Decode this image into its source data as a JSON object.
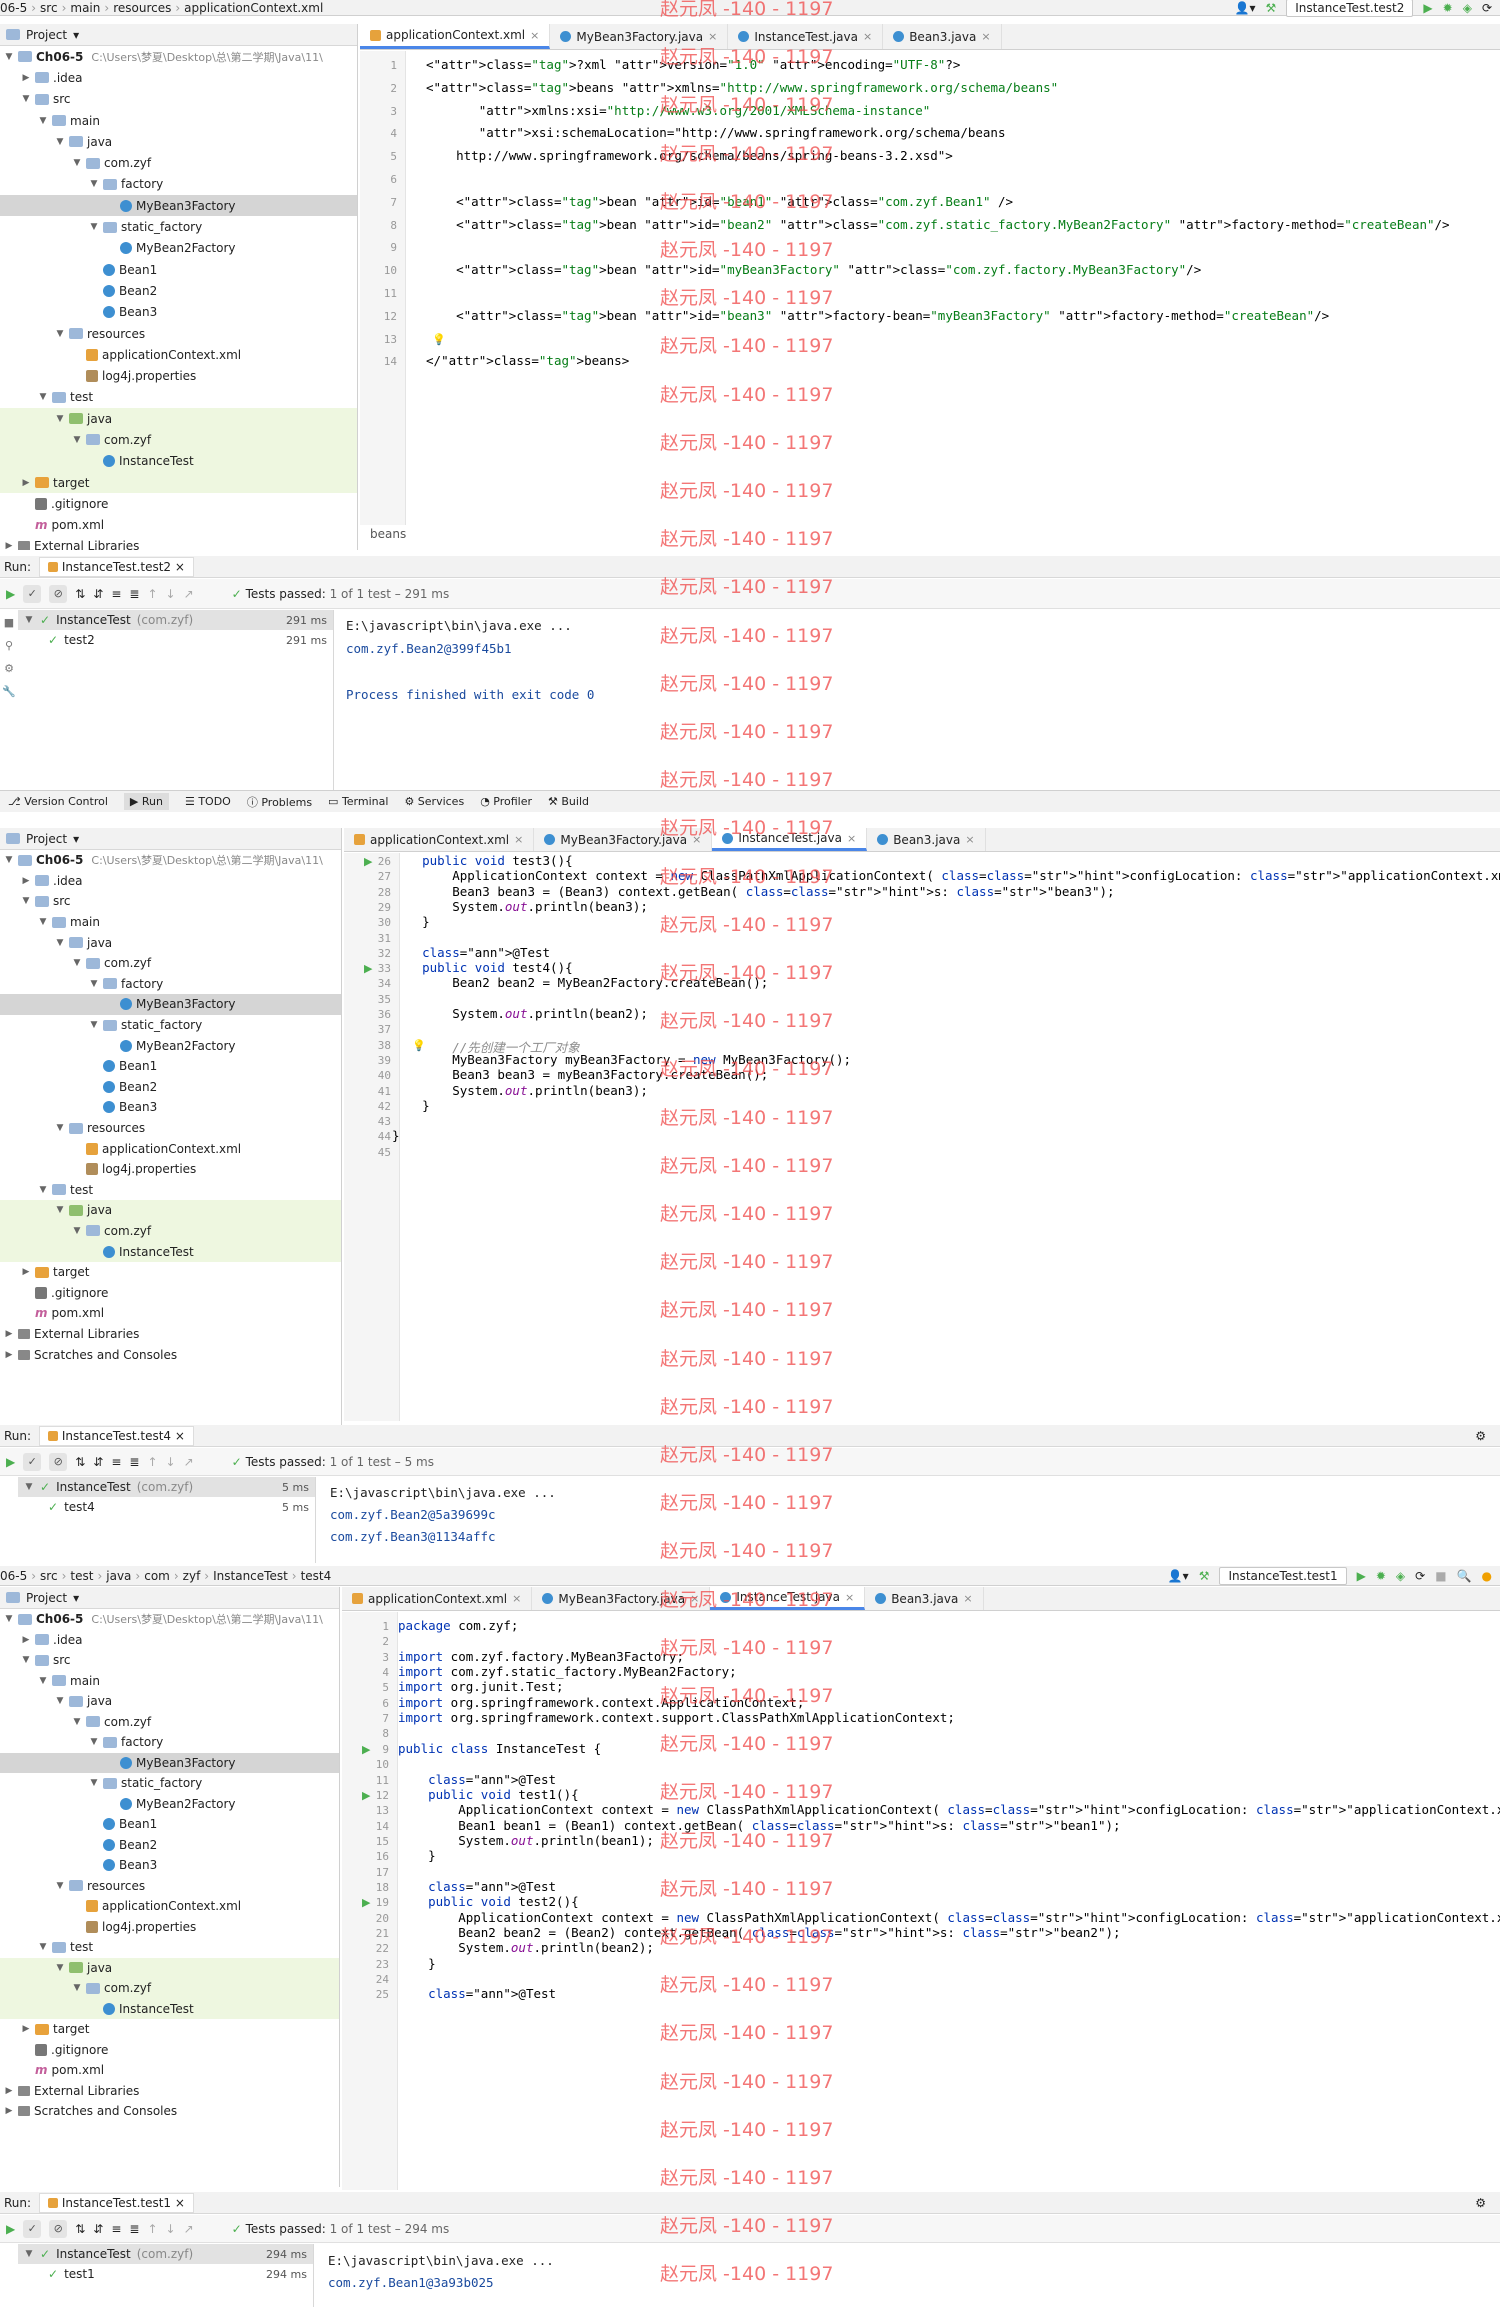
{
  "screenshot1": {
    "breadcrumb": [
      "06-5",
      "src",
      "main",
      "resources",
      "applicationContext.xml"
    ],
    "run_config": "InstanceTest.test2",
    "tabs": [
      {
        "label": "applicationContext.xml",
        "icon": "xml-file-icon",
        "active": true
      },
      {
        "label": "MyBean3Factory.java",
        "icon": "class-icon",
        "active": false
      },
      {
        "label": "InstanceTest.java",
        "icon": "class-icon",
        "active": false
      },
      {
        "label": "Bean3.java",
        "icon": "class-icon",
        "active": false
      }
    ],
    "project_label": "Project",
    "tree": [
      {
        "label": "Ch06-5",
        "path": "C:\\Users\\梦夏\\Desktop\\总\\第二学期\\Java\\11\\",
        "depth": 0,
        "icon": "folder",
        "open": true
      },
      {
        "label": ".idea",
        "depth": 1,
        "icon": "folder",
        "open": false
      },
      {
        "label": "src",
        "depth": 1,
        "icon": "folder",
        "open": true
      },
      {
        "label": "main",
        "depth": 2,
        "icon": "folder",
        "open": true
      },
      {
        "label": "java",
        "depth": 3,
        "icon": "folder",
        "open": true
      },
      {
        "label": "com.zyf",
        "depth": 4,
        "icon": "folder",
        "open": true
      },
      {
        "label": "factory",
        "depth": 5,
        "icon": "folder",
        "open": true
      },
      {
        "label": "MyBean3Factory",
        "depth": 6,
        "icon": "class",
        "selected": true
      },
      {
        "label": "static_factory",
        "depth": 5,
        "icon": "folder",
        "open": true
      },
      {
        "label": "MyBean2Factory",
        "depth": 6,
        "icon": "class"
      },
      {
        "label": "Bean1",
        "depth": 5,
        "icon": "class"
      },
      {
        "label": "Bean2",
        "depth": 5,
        "icon": "class"
      },
      {
        "label": "Bean3",
        "depth": 5,
        "icon": "class"
      },
      {
        "label": "resources",
        "depth": 3,
        "icon": "folder",
        "open": true
      },
      {
        "label": "applicationContext.xml",
        "depth": 4,
        "icon": "xml"
      },
      {
        "label": "log4j.properties",
        "depth": 4,
        "icon": "prop"
      },
      {
        "label": "test",
        "depth": 2,
        "icon": "folder",
        "open": true
      },
      {
        "label": "java",
        "depth": 3,
        "icon": "folderg",
        "open": true,
        "hl": true
      },
      {
        "label": "com.zyf",
        "depth": 4,
        "icon": "folder",
        "open": true,
        "hl": true
      },
      {
        "label": "InstanceTest",
        "depth": 5,
        "icon": "class",
        "hl": true
      },
      {
        "label": "target",
        "depth": 1,
        "icon": "foldero",
        "open": false,
        "hl": true
      },
      {
        "label": ".gitignore",
        "depth": 1,
        "icon": "git"
      },
      {
        "label": "pom.xml",
        "depth": 1,
        "icon": "m"
      },
      {
        "label": "External Libraries",
        "depth": 0,
        "icon": "lib",
        "open": false
      }
    ],
    "code_lines": [
      "<?xml version=\"1.0\" encoding=\"UTF-8\"?>",
      "<beans xmlns=\"http://www.springframework.org/schema/beans\"",
      "       xmlns:xsi=\"http://www.w3.org/2001/XMLSchema-instance\"",
      "       xsi:schemaLocation=\"http://www.springframework.org/schema/beans",
      "    http://www.springframework.org/schema/beans/spring-beans-3.2.xsd\">",
      "",
      "    <bean id=\"bean1\" class=\"com.zyf.Bean1\" />",
      "    <bean id=\"bean2\" class=\"com.zyf.static_factory.MyBean2Factory\" factory-method=\"createBean\"/>",
      "",
      "    <bean id=\"myBean3Factory\" class=\"com.zyf.factory.MyBean3Factory\"/>",
      "",
      "    <bean id=\"bean3\" factory-bean=\"myBean3Factory\" factory-method=\"createBean\"/>",
      "",
      "</beans>"
    ],
    "editor_breadcrumb": "beans",
    "run_label": "Run:",
    "run_tab": "InstanceTest.test2",
    "tests_passed": "Tests passed:",
    "tests_count": "1 of 1 test – 291 ms",
    "run_tree": [
      {
        "label": "InstanceTest",
        "sub": "(com.zyf)",
        "ms": "291 ms",
        "depth": 0
      },
      {
        "label": "test2",
        "ms": "291 ms",
        "depth": 1
      }
    ],
    "console": [
      "E:\\javascript\\bin\\java.exe ...",
      "com.zyf.Bean2@399f45b1",
      "",
      "Process finished with exit code 0"
    ],
    "status_tabs": [
      "Version Control",
      "Run",
      "TODO",
      "Problems",
      "Terminal",
      "Services",
      "Profiler",
      "Build"
    ]
  },
  "screenshot2": {
    "tabs": [
      {
        "label": "applicationContext.xml",
        "icon": "xml-file-icon",
        "active": false
      },
      {
        "label": "MyBean3Factory.java",
        "icon": "class-icon",
        "active": false
      },
      {
        "label": "InstanceTest.java",
        "icon": "class-icon",
        "active": true
      },
      {
        "label": "Bean3.java",
        "icon": "class-icon",
        "active": false
      }
    ],
    "project_label": "Project",
    "tree": [
      {
        "label": "Ch06-5",
        "path": "C:\\Users\\梦夏\\Desktop\\总\\第二学期\\Java\\11\\",
        "depth": 0,
        "icon": "folder",
        "open": true
      },
      {
        "label": ".idea",
        "depth": 1,
        "icon": "folder",
        "open": false
      },
      {
        "label": "src",
        "depth": 1,
        "icon": "folder",
        "open": true
      },
      {
        "label": "main",
        "depth": 2,
        "icon": "folder",
        "open": true
      },
      {
        "label": "java",
        "depth": 3,
        "icon": "folder",
        "open": true
      },
      {
        "label": "com.zyf",
        "depth": 4,
        "icon": "folder",
        "open": true
      },
      {
        "label": "factory",
        "depth": 5,
        "icon": "folder",
        "open": true
      },
      {
        "label": "MyBean3Factory",
        "depth": 6,
        "icon": "class",
        "selected": true
      },
      {
        "label": "static_factory",
        "depth": 5,
        "icon": "folder",
        "open": true
      },
      {
        "label": "MyBean2Factory",
        "depth": 6,
        "icon": "class"
      },
      {
        "label": "Bean1",
        "depth": 5,
        "icon": "class"
      },
      {
        "label": "Bean2",
        "depth": 5,
        "icon": "class"
      },
      {
        "label": "Bean3",
        "depth": 5,
        "icon": "class"
      },
      {
        "label": "resources",
        "depth": 3,
        "icon": "folder",
        "open": true
      },
      {
        "label": "applicationContext.xml",
        "depth": 4,
        "icon": "xml"
      },
      {
        "label": "log4j.properties",
        "depth": 4,
        "icon": "prop"
      },
      {
        "label": "test",
        "depth": 2,
        "icon": "folder",
        "open": true
      },
      {
        "label": "java",
        "depth": 3,
        "icon": "folderg",
        "open": true,
        "hl": true
      },
      {
        "label": "com.zyf",
        "depth": 4,
        "icon": "folder",
        "open": true,
        "hl": true
      },
      {
        "label": "InstanceTest",
        "depth": 5,
        "icon": "class",
        "hl": true
      },
      {
        "label": "target",
        "depth": 1,
        "icon": "foldero",
        "open": false
      },
      {
        "label": ".gitignore",
        "depth": 1,
        "icon": "git"
      },
      {
        "label": "pom.xml",
        "depth": 1,
        "icon": "m"
      },
      {
        "label": "External Libraries",
        "depth": 0,
        "icon": "lib",
        "open": false
      },
      {
        "label": "Scratches and Consoles",
        "depth": 0,
        "icon": "lib",
        "open": false
      }
    ],
    "first_line_no": 26,
    "code_lines": [
      "    public void test3(){",
      "        ApplicationContext context = new ClassPathXmlApplicationContext( configLocation: \"applicationContext.xml\");",
      "        Bean3 bean3 = (Bean3) context.getBean( s: \"bean3\");",
      "        System.out.println(bean3);",
      "    }",
      "",
      "    @Test",
      "    public void test4(){",
      "        Bean2 bean2 = MyBean2Factory.createBean();",
      "",
      "        System.out.println(bean2);",
      "",
      "        //先创建一个工厂对象",
      "        MyBean3Factory myBean3Factory = new MyBean3Factory();",
      "        Bean3 bean3 = myBean3Factory.createBean();",
      "        System.out.println(bean3);",
      "    }",
      "",
      "}",
      ""
    ],
    "run_label": "Run:",
    "run_tab": "InstanceTest.test4",
    "tests_passed": "Tests passed:",
    "tests_count": "1 of 1 test – 5 ms",
    "run_tree": [
      {
        "label": "InstanceTest",
        "sub": "(com.zyf)",
        "ms": "5 ms",
        "depth": 0
      },
      {
        "label": "test4",
        "ms": "5 ms",
        "depth": 1
      }
    ],
    "console": [
      "E:\\javascript\\bin\\java.exe ...",
      "com.zyf.Bean2@5a39699c",
      "com.zyf.Bean3@1134affc"
    ]
  },
  "screenshot3": {
    "breadcrumb": [
      "06-5",
      "src",
      "test",
      "java",
      "com",
      "zyf",
      "InstanceTest",
      "test4"
    ],
    "run_config": "InstanceTest.test1",
    "tabs": [
      {
        "label": "applicationContext.xml",
        "icon": "xml-file-icon",
        "active": false
      },
      {
        "label": "MyBean3Factory.java",
        "icon": "class-icon",
        "active": false
      },
      {
        "label": "InstanceTest.java",
        "icon": "class-icon",
        "active": true
      },
      {
        "label": "Bean3.java",
        "icon": "class-icon",
        "active": false
      }
    ],
    "project_label": "Project",
    "tree": [
      {
        "label": "Ch06-5",
        "path": "C:\\Users\\梦夏\\Desktop\\总\\第二学期\\Java\\11\\",
        "depth": 0,
        "icon": "folder",
        "open": true
      },
      {
        "label": ".idea",
        "depth": 1,
        "icon": "folder",
        "open": false
      },
      {
        "label": "src",
        "depth": 1,
        "icon": "folder",
        "open": true
      },
      {
        "label": "main",
        "depth": 2,
        "icon": "folder",
        "open": true
      },
      {
        "label": "java",
        "depth": 3,
        "icon": "folder",
        "open": true
      },
      {
        "label": "com.zyf",
        "depth": 4,
        "icon": "folder",
        "open": true
      },
      {
        "label": "factory",
        "depth": 5,
        "icon": "folder",
        "open": true
      },
      {
        "label": "MyBean3Factory",
        "depth": 6,
        "icon": "class",
        "selected": true
      },
      {
        "label": "static_factory",
        "depth": 5,
        "icon": "folder",
        "open": true
      },
      {
        "label": "MyBean2Factory",
        "depth": 6,
        "icon": "class"
      },
      {
        "label": "Bean1",
        "depth": 5,
        "icon": "class"
      },
      {
        "label": "Bean2",
        "depth": 5,
        "icon": "class"
      },
      {
        "label": "Bean3",
        "depth": 5,
        "icon": "class"
      },
      {
        "label": "resources",
        "depth": 3,
        "icon": "folder",
        "open": true
      },
      {
        "label": "applicationContext.xml",
        "depth": 4,
        "icon": "xml"
      },
      {
        "label": "log4j.properties",
        "depth": 4,
        "icon": "prop"
      },
      {
        "label": "test",
        "depth": 2,
        "icon": "folder",
        "open": true
      },
      {
        "label": "java",
        "depth": 3,
        "icon": "folderg",
        "open": true,
        "hl": true
      },
      {
        "label": "com.zyf",
        "depth": 4,
        "icon": "folder",
        "open": true,
        "hl": true
      },
      {
        "label": "InstanceTest",
        "depth": 5,
        "icon": "class",
        "hl": true
      },
      {
        "label": "target",
        "depth": 1,
        "icon": "foldero",
        "open": false
      },
      {
        "label": ".gitignore",
        "depth": 1,
        "icon": "git"
      },
      {
        "label": "pom.xml",
        "depth": 1,
        "icon": "m"
      },
      {
        "label": "External Libraries",
        "depth": 0,
        "icon": "lib",
        "open": false
      },
      {
        "label": "Scratches and Consoles",
        "depth": 0,
        "icon": "lib",
        "open": false
      }
    ],
    "first_line_no": 1,
    "code_lines": [
      "package com.zyf;",
      "",
      "import com.zyf.factory.MyBean3Factory;",
      "import com.zyf.static_factory.MyBean2Factory;",
      "import org.junit.Test;",
      "import org.springframework.context.ApplicationContext;",
      "import org.springframework.context.support.ClassPathXmlApplicationContext;",
      "",
      "public class InstanceTest {",
      "",
      "    @Test",
      "    public void test1(){",
      "        ApplicationContext context = new ClassPathXmlApplicationContext( configLocation: \"applicationContext.xml\");",
      "        Bean1 bean1 = (Bean1) context.getBean( s: \"bean1\");",
      "        System.out.println(bean1);",
      "    }",
      "",
      "    @Test",
      "    public void test2(){",
      "        ApplicationContext context = new ClassPathXmlApplicationContext( configLocation: \"applicationContext.xml\");",
      "        Bean2 bean2 = (Bean2) context.getBean( s: \"bean2\");",
      "        System.out.println(bean2);",
      "    }",
      "",
      "    @Test"
    ],
    "run_label": "Run:",
    "run_tab": "InstanceTest.test1",
    "tests_passed": "Tests passed:",
    "tests_count": "1 of 1 test – 294 ms",
    "run_tree": [
      {
        "label": "InstanceTest",
        "sub": "(com.zyf)",
        "ms": "294 ms",
        "depth": 0
      },
      {
        "label": "test1",
        "ms": "294 ms",
        "depth": 1
      }
    ],
    "console": [
      "E:\\javascript\\bin\\java.exe ...",
      "com.zyf.Bean1@3a93b025"
    ]
  },
  "watermark": "赵元凤 -140 - 1197"
}
